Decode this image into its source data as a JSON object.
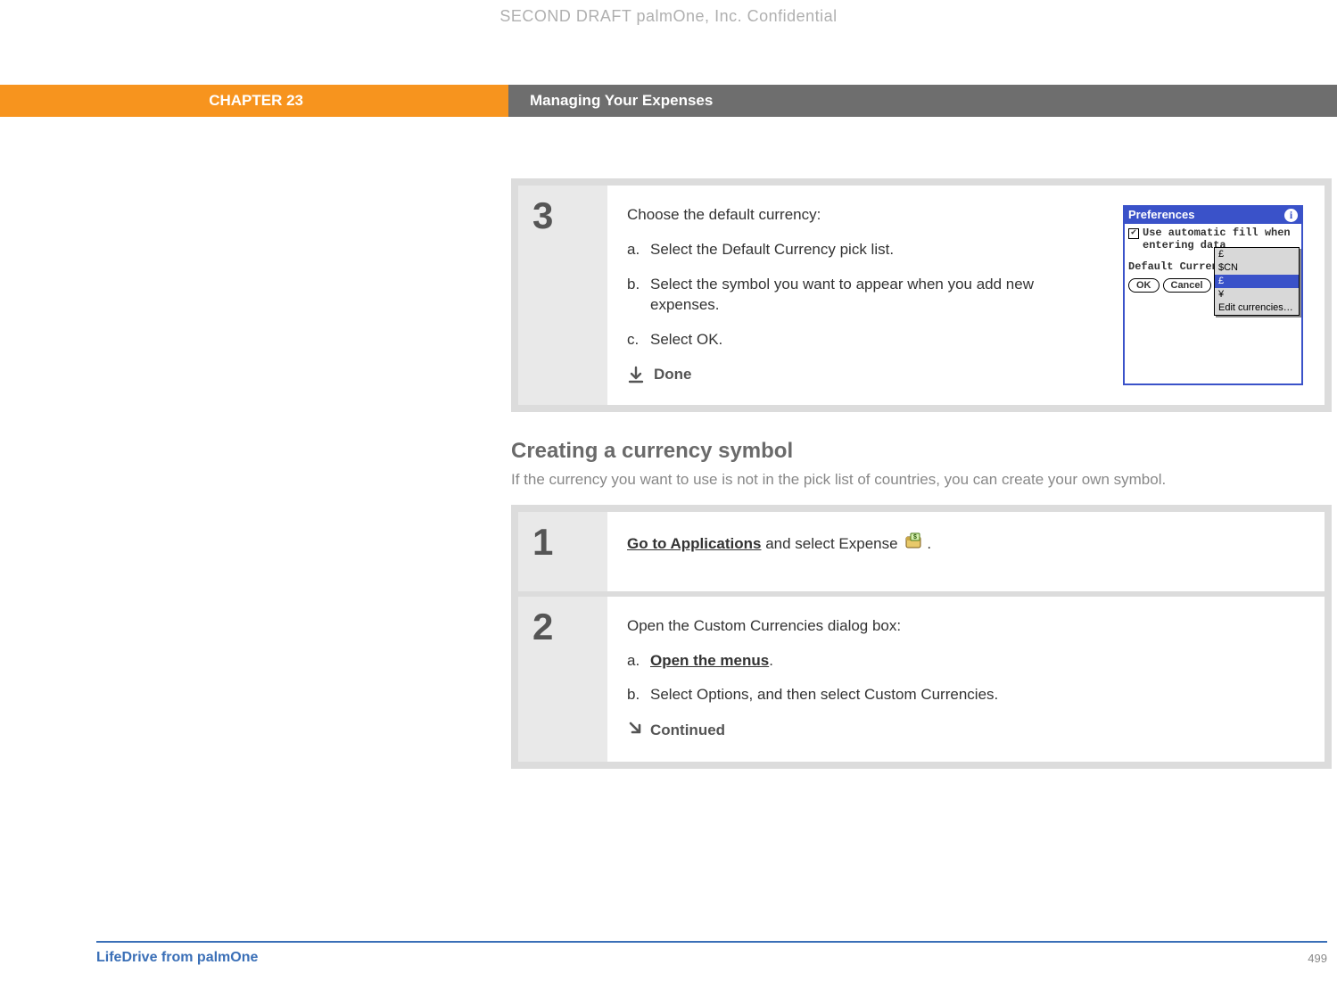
{
  "watermark": "SECOND DRAFT palmOne, Inc.  Confidential",
  "header": {
    "chapter": "CHAPTER 23",
    "title": "Managing Your Expenses"
  },
  "step3": {
    "number": "3",
    "intro": "Choose the default currency:",
    "a_letter": "a.",
    "a_text": "Select the Default Currency pick list.",
    "b_letter": "b.",
    "b_text": "Select the symbol you want to appear when you add new expenses.",
    "c_letter": "c.",
    "c_text": "Select OK.",
    "done": "Done"
  },
  "prefs": {
    "title": "Preferences",
    "checkbox_label": "Use automatic fill when entering data",
    "default_label": "Default Currenc",
    "ok": "OK",
    "cancel": "Cancel",
    "options": {
      "o1": "£",
      "o2": "$CN",
      "o3": "£",
      "o4": "¥",
      "o5": "Edit currencies…"
    }
  },
  "section": {
    "heading": "Creating a currency symbol",
    "para": "If the currency you want to use is not in the pick list of countries, you can create your own symbol."
  },
  "step1": {
    "number": "1",
    "link": "Go to Applications",
    "rest": " and select Expense ",
    "period": "."
  },
  "step2": {
    "number": "2",
    "intro": "Open the Custom Currencies dialog box:",
    "a_letter": "a.",
    "a_link": "Open the menus",
    "a_period": ".",
    "b_letter": "b.",
    "b_text": "Select Options, and then select Custom Currencies.",
    "continued": "Continued"
  },
  "footer": {
    "product": "LifeDrive from palmOne",
    "page": "499"
  }
}
